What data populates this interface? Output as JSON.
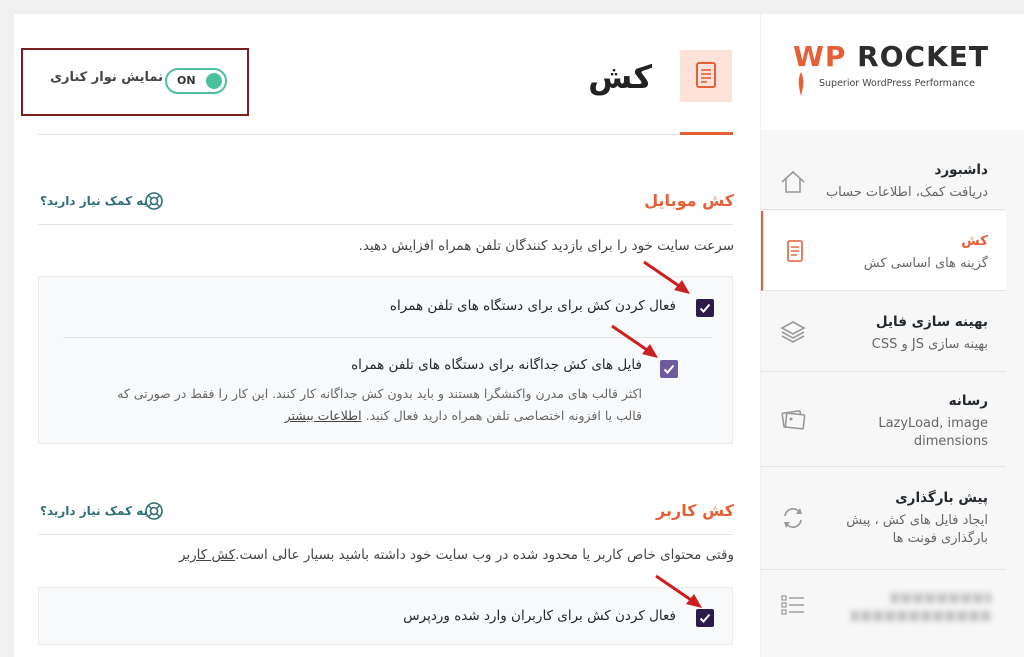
{
  "logo": {
    "wp": "WP",
    "rocket": "ROCKET",
    "tagline": "Superior WordPress Performance"
  },
  "sidebar": {
    "items": [
      {
        "title": "داشبورد",
        "subtitle": "دریافت کمک، اطلاعات حساب",
        "icon": "house-icon"
      },
      {
        "title": "کش",
        "subtitle": "گزینه های اساسی کش",
        "icon": "document-icon",
        "active": true
      },
      {
        "title": "بهینه سازی فایل",
        "subtitle": "بهینه سازی JS و CSS",
        "icon": "layers-icon"
      },
      {
        "title": "رسانه",
        "subtitle_line1": "LazyLoad, image",
        "subtitle_line2": "dimensions",
        "icon": "images-icon"
      },
      {
        "title": "پیش بارگذاری",
        "subtitle_line1": "ایجاد فایل های کش ، پیش",
        "subtitle_line2": "بارگذاری فونت ها",
        "icon": "refresh-icon"
      }
    ]
  },
  "header": {
    "title": "کش",
    "toggle_label": "نمایش نوار کناری",
    "toggle_state": "ON"
  },
  "sections": {
    "mobile": {
      "title": "کش موبایل",
      "help": "به کمک نیاز دارید؟",
      "description": "سرعت سایت خود را برای بازدید کنندگان تلفن همراه افزایش دهید.",
      "option1": "فعال کردن کش برای برای دستگاه های تلفن همراه",
      "option2": "فایل های کش جداگانه برای دستگاه های تلفن همراه",
      "option2_desc_line1": "اکثر قالب های مدرن واکنشگرا هستند و باید بدون کش جداگانه کار کنند. این کار را فقط در صورتی که",
      "option2_desc_line2": "قالب یا افزونه اختصاصی تلفن همراه دارید فعال کنید.",
      "more_info": "اطلاعات بیشتر"
    },
    "user": {
      "title": "کش کاربر",
      "help": "به کمک نیاز دارید؟",
      "description_link": "کش کاربر",
      "description_rest": " وقتی محتوای خاص کاربر یا محدود شده در وب سایت خود داشته باشید بسیار عالی است.",
      "option1": "فعال کردن کش برای کاربران وارد شده وردپرس"
    }
  },
  "colors": {
    "accent": "#e65f36",
    "toggle_green": "#4cc09d",
    "help_teal": "#2e6f77",
    "checkbox_dark": "#2c1b4a",
    "highlight_border": "#7a1e1e"
  }
}
